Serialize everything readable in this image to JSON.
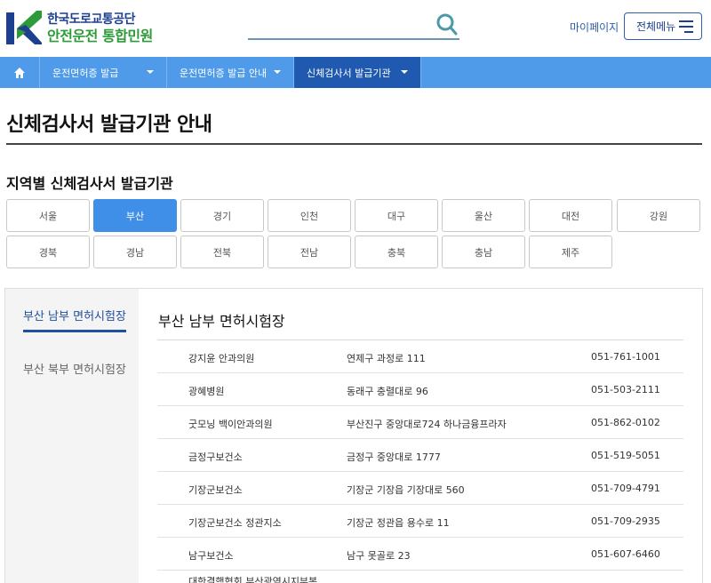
{
  "header": {
    "logo_line1": "한국도로교통공단",
    "logo_line2": "안전운전 통합민원",
    "search_placeholder": "",
    "mypage_label": "마이페이지",
    "menu_label": "전체메뉴"
  },
  "nav": {
    "home_icon": "home-icon",
    "items": [
      {
        "label": "운전면허증 발급"
      },
      {
        "label": "운전면허증 발급 안내"
      },
      {
        "label": "신체검사서 발급기관"
      }
    ]
  },
  "page_title": "신체검사서 발급기관 안내",
  "section_title": "지역별 신체검사서 발급기관",
  "regions": [
    "서울",
    "부산",
    "경기",
    "인천",
    "대구",
    "울산",
    "대전",
    "강원",
    "경북",
    "경남",
    "전북",
    "전남",
    "충북",
    "충남",
    "제주"
  ],
  "selected_region": "부산",
  "side_tabs": [
    "부산 남부 면허시험장",
    "부산 북부 면허시험장"
  ],
  "content_title": "부산 남부 면허시험장",
  "institutions": [
    {
      "name": "강지윤 안과의원",
      "address": "연제구 과정로 111",
      "phone": "051-761-1001"
    },
    {
      "name": "광혜병원",
      "address": "동래구 충렬대로 96",
      "phone": "051-503-2111"
    },
    {
      "name": "굿모닝 백이안과의원",
      "address": "부산진구 중앙대로724 하나금융프라자",
      "phone": "051-862-0102"
    },
    {
      "name": "금정구보건소",
      "address": "금정구 중앙대로 1777",
      "phone": "051-519-5051"
    },
    {
      "name": "기장군보건소",
      "address": "기장군 기장읍 기장대로 560",
      "phone": "051-709-4791"
    },
    {
      "name": "기장군보건소 정관지소",
      "address": "기장군 정관읍 용수로 11",
      "phone": "051-709-2935"
    },
    {
      "name": "남구보건소",
      "address": "남구 못골로 23",
      "phone": "051-607-6460"
    },
    {
      "name": "대한결핵협회 부산광역시지부복",
      "address": "",
      "phone": ""
    }
  ],
  "colors": {
    "nav": "#4f9bea",
    "nav_active": "#1f5ab0",
    "region_active": "#3f8fe8",
    "brand_blue": "#1d3f8f",
    "brand_green": "#2e9b3a"
  }
}
